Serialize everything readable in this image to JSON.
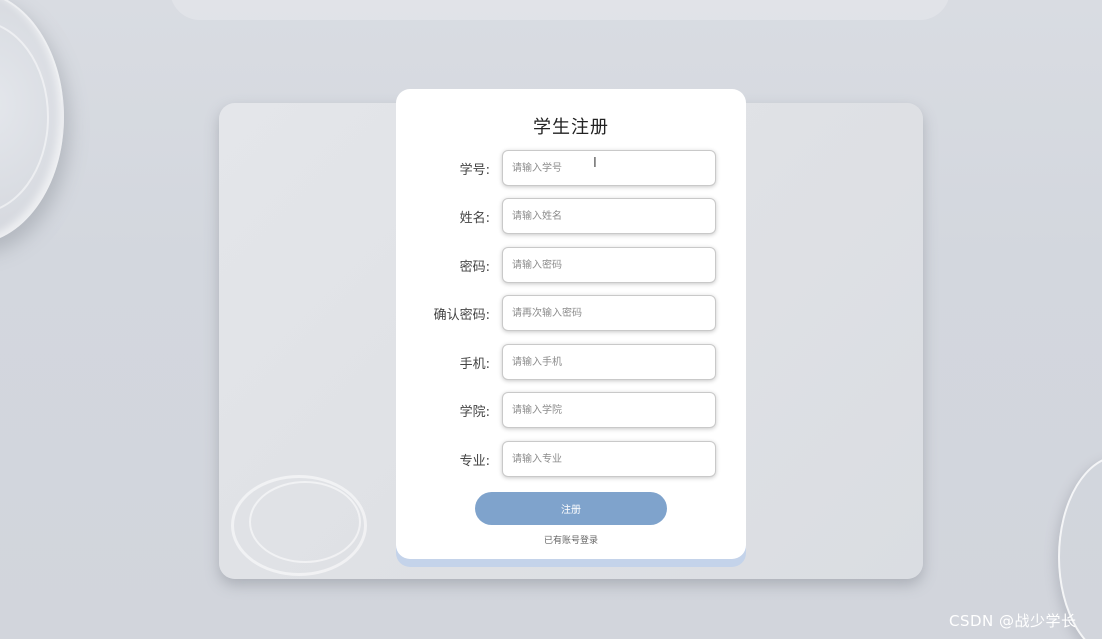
{
  "form": {
    "title": "学生注册",
    "fields": [
      {
        "label": "学号:",
        "placeholder": "请输入学号",
        "type": "text"
      },
      {
        "label": "姓名:",
        "placeholder": "请输入姓名",
        "type": "text"
      },
      {
        "label": "密码:",
        "placeholder": "请输入密码",
        "type": "password"
      },
      {
        "label": "确认密码:",
        "placeholder": "请再次输入密码",
        "type": "password"
      },
      {
        "label": "手机:",
        "placeholder": "请输入手机",
        "type": "text"
      },
      {
        "label": "学院:",
        "placeholder": "请输入学院",
        "type": "text"
      },
      {
        "label": "专业:",
        "placeholder": "请输入专业",
        "type": "text"
      }
    ],
    "submit_label": "注册",
    "login_link": "已有账号登录"
  },
  "cursor_glyph": "I",
  "watermark": "CSDN @战少学长",
  "colors": {
    "background": "#d3d7de",
    "button": "#7fa3cc",
    "card": "#ffffff",
    "card_accent": "#c4d3ea"
  }
}
